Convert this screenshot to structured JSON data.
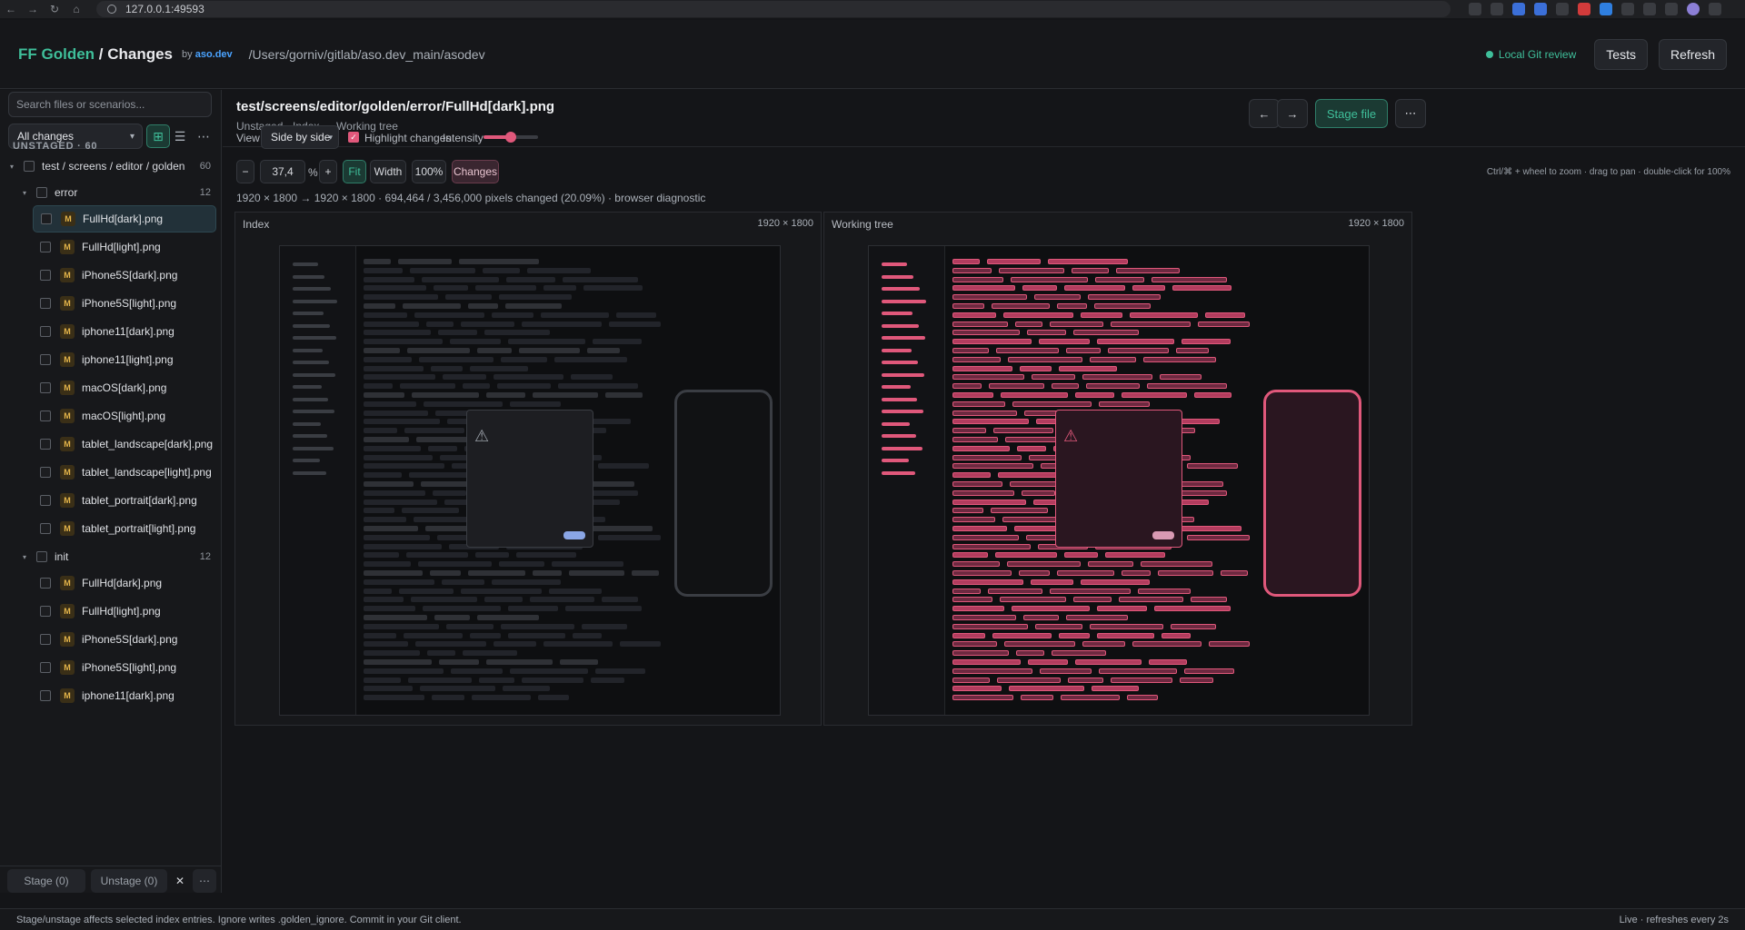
{
  "browser": {
    "url": "127.0.0.1:49593"
  },
  "header": {
    "brand_golden": "FF Golden",
    "brand_sep": " / Changes",
    "by_prefix": "by",
    "by_link": "aso.dev",
    "path": "/Users/gorniv/gitlab/aso.dev_main/asodev",
    "review_status": "Local Git review",
    "tests_label": "Tests",
    "refresh_label": "Refresh"
  },
  "sidebar": {
    "search_placeholder": "Search files or scenarios...",
    "filter_value": "All changes",
    "section_label": "UNSTAGED · 60",
    "root": {
      "label": "test / screens / editor / golden",
      "count": "60"
    },
    "groups": [
      {
        "label": "error",
        "count": "12",
        "files": [
          "FullHd[dark].png",
          "FullHd[light].png",
          "iPhone5S[dark].png",
          "iPhone5S[light].png",
          "iphone11[dark].png",
          "iphone11[light].png",
          "macOS[dark].png",
          "macOS[light].png",
          "tablet_landscape[dark].png",
          "tablet_landscape[light].png",
          "tablet_portrait[dark].png",
          "tablet_portrait[light].png"
        ]
      },
      {
        "label": "init",
        "count": "12",
        "files": [
          "FullHd[dark].png",
          "FullHd[light].png",
          "iPhone5S[dark].png",
          "iPhone5S[light].png",
          "iphone11[dark].png"
        ]
      }
    ],
    "file_badge": "M",
    "stage_label": "Stage (0)",
    "unstage_label": "Unstage (0)"
  },
  "main": {
    "file_path": "test/screens/editor/golden/error/FullHd[dark].png",
    "file_subtitle": "Unstaged · Index → Working tree",
    "stage_file_label": "Stage file",
    "view_label": "View",
    "view_value": "Side by side",
    "highlight_label": "Highlight changes",
    "highlight_checked": true,
    "intensity_label": "Intensity",
    "intensity_value": 0.5,
    "zoom_minus": "−",
    "zoom_value": "37,4",
    "zoom_unit": "%",
    "zoom_plus": "+",
    "fit_label": "Fit",
    "width_label": "Width",
    "full_label": "100%",
    "changes_label": "Changes",
    "zoom_hint": "Ctrl/⌘ + wheel to zoom · drag to pan · double-click for 100%",
    "stats": "1920 × 1800 → 1920 × 1800 · 694,464 / 3,456,000 pixels changed (20.09%) · browser diagnostic",
    "panes": [
      {
        "title": "Index",
        "dims": "1920 × 1800"
      },
      {
        "title": "Working tree",
        "dims": "1920 × 1800"
      }
    ]
  },
  "status": {
    "left": "Stage/unstage affects selected index entries. Ignore writes .golden_ignore. Commit in your Git client.",
    "right": "Live · refreshes every 2s"
  },
  "colors": {
    "accent_green": "#3fbf9a",
    "accent_pink": "#e0587b",
    "link_blue": "#4aa3ff",
    "modified_badge": "#e5b64a"
  }
}
